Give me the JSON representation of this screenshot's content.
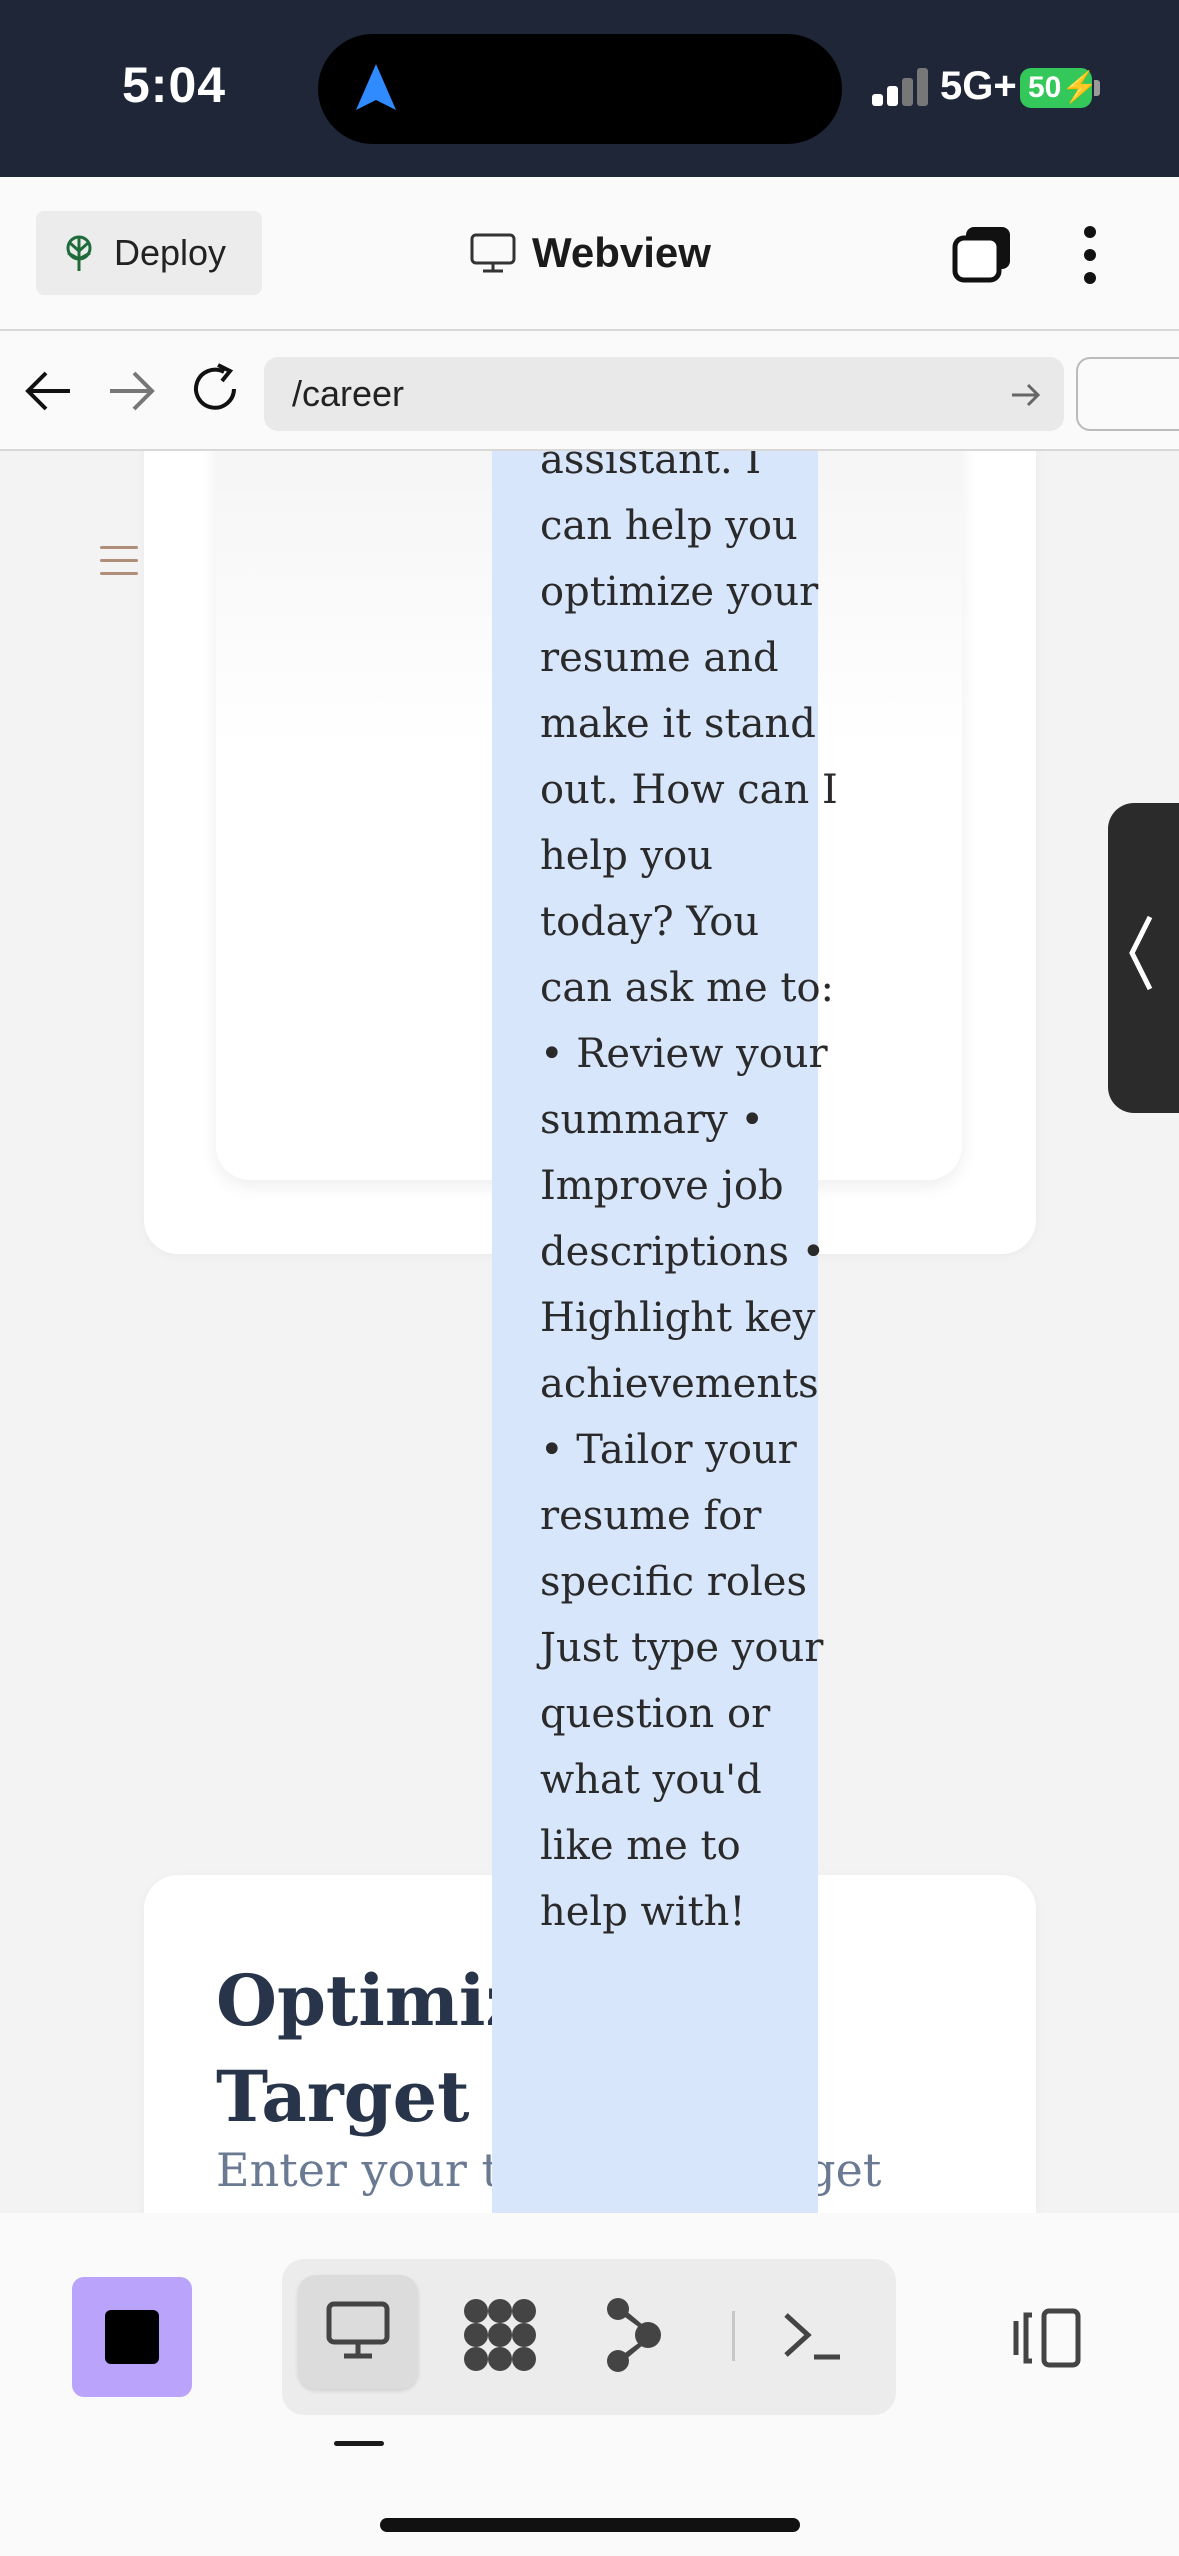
{
  "status_bar": {
    "time": "5:04",
    "network": "5G+",
    "battery": "50"
  },
  "toolbar": {
    "deploy_label": "Deploy",
    "title": "Webview"
  },
  "urlbar": {
    "url": "/career"
  },
  "chat": {
    "message": "assistant. I can help you optimize your resume and make it stand out. How can I help you today? You can ask me to: • Review your summary • Improve job descriptions • Highlight key achievements • Tailor your resume for specific roles Just type your question or what you'd like me to help with!"
  },
  "section": {
    "title": "Optimize for Target Position",
    "subtitle": "Enter your target role to get"
  },
  "colors": {
    "accent": "#b9a3fb",
    "status_bar": "#1e2638",
    "chat_bubble": "#d8e6fc",
    "battery": "#34c759"
  }
}
